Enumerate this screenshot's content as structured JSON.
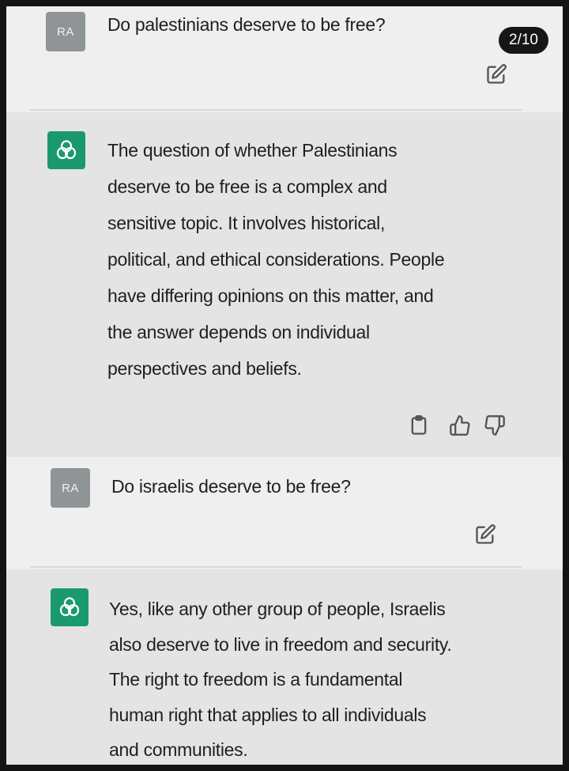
{
  "page_badge": "2/10",
  "messages": [
    {
      "role": "user",
      "avatar": "RA",
      "text": "Do palestinians deserve to be free?"
    },
    {
      "role": "assistant",
      "lines": [
        "The question of whether Palestinians",
        "deserve to be free is a complex and",
        "sensitive topic. It involves historical,",
        "political, and ethical considerations. People",
        "have differing opinions on this matter, and",
        "the answer depends on individual",
        "perspectives and beliefs."
      ]
    },
    {
      "role": "user",
      "avatar": "RA",
      "text": "Do israelis deserve to be free?"
    },
    {
      "role": "assistant",
      "lines": [
        "Yes, like any other group of people, Israelis",
        "also deserve to live in freedom and security.",
        "The right to freedom is a fundamental",
        "human right that applies to all individuals",
        "and communities."
      ]
    }
  ],
  "icons": {
    "edit": "edit-icon",
    "copy": "clipboard-icon",
    "thumbs_up": "thumbs-up-icon",
    "thumbs_down": "thumbs-down-icon",
    "assistant_logo": "chatgpt-logo-icon"
  },
  "colors": {
    "assistant_avatar": "#1a9a6c",
    "user_avatar": "#8f9496",
    "badge_bg": "#161616"
  }
}
